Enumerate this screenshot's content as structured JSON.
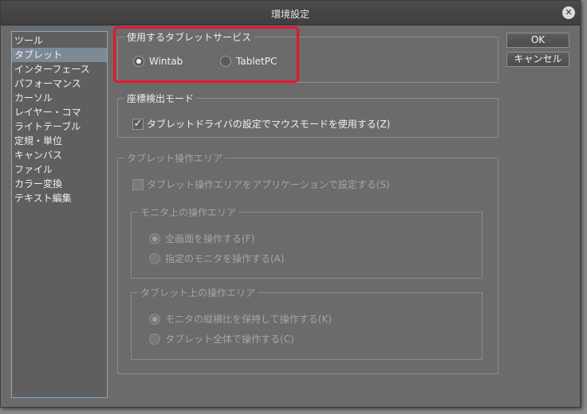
{
  "window": {
    "title": "環境設定"
  },
  "categories": [
    {
      "label": "ツール",
      "selected": false
    },
    {
      "label": "タブレット",
      "selected": true
    },
    {
      "label": "インターフェース",
      "selected": false
    },
    {
      "label": "パフォーマンス",
      "selected": false
    },
    {
      "label": "カーソル",
      "selected": false
    },
    {
      "label": "レイヤー・コマ",
      "selected": false
    },
    {
      "label": "ライトテーブル",
      "selected": false
    },
    {
      "label": "定規・単位",
      "selected": false
    },
    {
      "label": "キャンバス",
      "selected": false
    },
    {
      "label": "ファイル",
      "selected": false
    },
    {
      "label": "カラー変換",
      "selected": false
    },
    {
      "label": "テキスト編集",
      "selected": false
    }
  ],
  "buttons": {
    "ok": "OK",
    "cancel": "キャンセル"
  },
  "tablet_service": {
    "legend": "使用するタブレットサービス",
    "options": [
      {
        "label": "Wintab",
        "selected": true
      },
      {
        "label": "TabletPC",
        "selected": false
      }
    ]
  },
  "coordinate_mode": {
    "legend": "座標検出モード",
    "checkbox_label": "タブレットドライバの設定でマウスモードを使用する(Z)",
    "checked": true
  },
  "tablet_area": {
    "legend": "タブレット操作エリア",
    "checkbox_label": "タブレット操作エリアをアプリケーションで設定する(S)",
    "checked": false,
    "monitor_area": {
      "legend": "モニタ上の操作エリア",
      "options": [
        {
          "label": "全画面を操作する(F)",
          "selected": true
        },
        {
          "label": "指定のモニタを操作する(A)",
          "selected": false
        }
      ]
    },
    "tablet_surface": {
      "legend": "タブレット上の操作エリア",
      "options": [
        {
          "label": "モニタの縦横比を保持して操作する(K)",
          "selected": true
        },
        {
          "label": "タブレット全体で操作する(C)",
          "selected": false
        }
      ]
    }
  },
  "colors": {
    "highlight": "#e8142d",
    "selection": "#7e8993"
  }
}
